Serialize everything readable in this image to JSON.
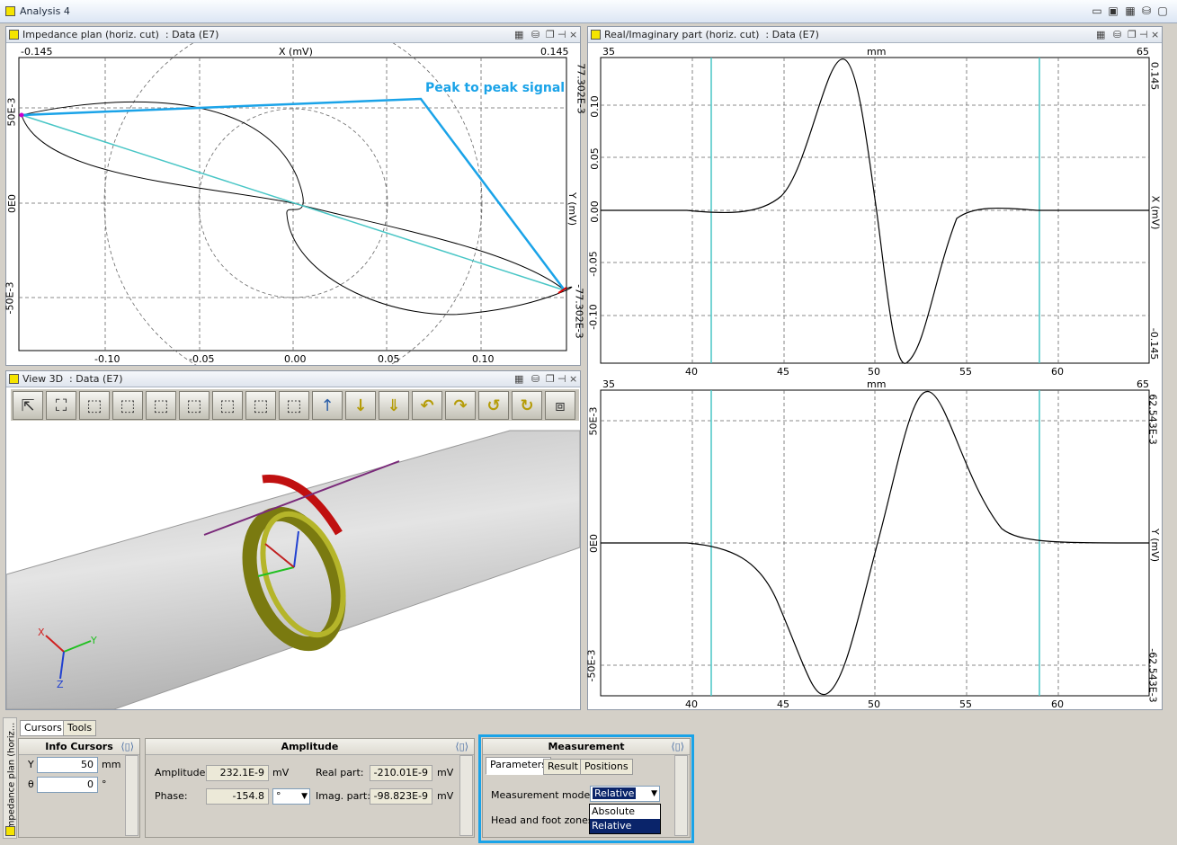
{
  "window": {
    "title": "Analysis 4"
  },
  "impedance": {
    "title": "Impedance plan (horiz. cut)  : Data (E7)",
    "x_axis_label": "X (mV)",
    "x_min_label": "-0.145",
    "x_max_label": "0.145",
    "y_axis_label": "Y (mV)",
    "y_top_label": "77.302E-3",
    "y_bottom_label": "-77.302E-3",
    "y_left_labels": [
      "50E-3",
      "0E0",
      "-50E-3"
    ],
    "x_ticks": [
      "-0.10",
      "-0.05",
      "0.00",
      "0.05",
      "0.10"
    ],
    "annotation": "Peak to peak signal"
  },
  "realimag": {
    "title": "Real/Imaginary part (horiz. cut)  : Data (E7)",
    "x_axis_label": "mm",
    "x_min_label": "35",
    "x_max_label": "65",
    "x_ticks": [
      "40",
      "45",
      "50",
      "55",
      "60"
    ],
    "top_y_label": "X (mV)",
    "top_y_max": "0.145",
    "top_y_min": "-0.145",
    "top_y_ticks": [
      "0.10",
      "0.05",
      "0.00",
      "-0.05",
      "-0.10"
    ],
    "bottom_y_label": "Y (mV)",
    "bottom_y_max": "62.543E-3",
    "bottom_y_min": "-62.543E-3",
    "bottom_y_ticks": [
      "50E-3",
      "0E0",
      "-50E-3"
    ]
  },
  "view3d": {
    "title": "View 3D  : Data (E7)",
    "axis_x": "X",
    "axis_y": "Y",
    "axis_z": "Z"
  },
  "bottom": {
    "side_label": "Impedance plan (horiz...",
    "tabs": [
      "Cursors",
      "Tools"
    ],
    "info": {
      "title": "Info Cursors",
      "y_label": "Y",
      "y_value": "50",
      "y_unit": "mm",
      "t_label": "θ",
      "t_value": "0",
      "t_unit": "°"
    },
    "amplitude": {
      "title": "Amplitude",
      "amp_label": "Amplitude:",
      "amp_value": "232.1E-9",
      "amp_unit": "mV",
      "phase_label": "Phase:",
      "phase_value": "-154.8",
      "phase_unit": "°",
      "real_label": "Real part:",
      "real_value": "-210.01E-9",
      "real_unit": "mV",
      "imag_label": "Imag. part:",
      "imag_value": "-98.823E-9",
      "imag_unit": "mV"
    },
    "measurement": {
      "title": "Measurement",
      "tabs": [
        "Parameters",
        "Result",
        "Positions"
      ],
      "mode_label": "Measurement mode:",
      "mode_value": "Relative",
      "zones_label": "Head and foot zones:",
      "options": [
        "Absolute",
        "Relative"
      ]
    }
  },
  "colors": {
    "highlight": "#1aa3e8",
    "cyan": "#49c6c6",
    "signal": "#000000"
  }
}
